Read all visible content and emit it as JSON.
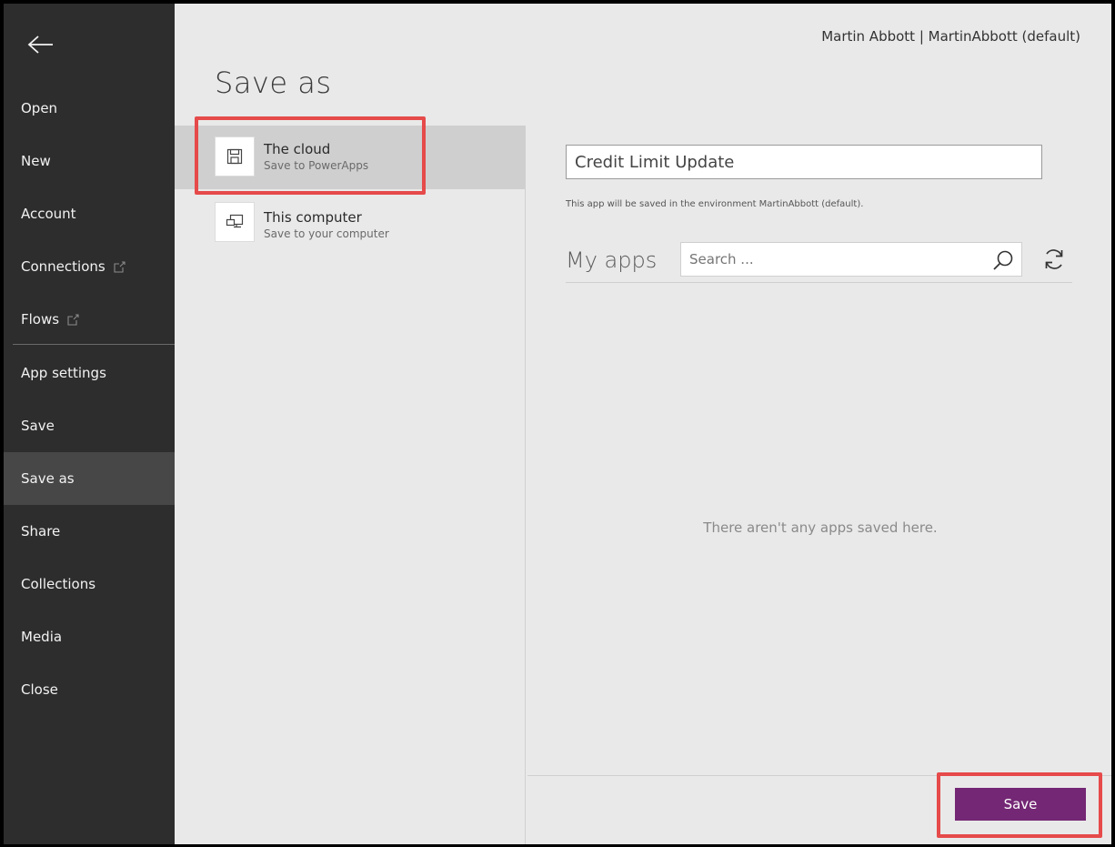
{
  "header": {
    "user": "Martin Abbott | MartinAbbott (default)",
    "title": "Save as"
  },
  "sidebar": {
    "back_icon": "back-arrow-icon",
    "items": [
      {
        "label": "Open"
      },
      {
        "label": "New"
      },
      {
        "label": "Account"
      },
      {
        "label": "Connections",
        "external": true
      },
      {
        "label": "Flows",
        "external": true
      },
      {
        "label": "App settings"
      },
      {
        "label": "Save"
      },
      {
        "label": "Save as",
        "active": true
      },
      {
        "label": "Share"
      },
      {
        "label": "Collections"
      },
      {
        "label": "Media"
      },
      {
        "label": "Close"
      }
    ]
  },
  "locations": [
    {
      "title": "The cloud",
      "subtitle": "Save to PowerApps",
      "icon": "save-icon",
      "selected": true
    },
    {
      "title": "This computer",
      "subtitle": "Save to your computer",
      "icon": "computer-icon",
      "selected": false
    }
  ],
  "main": {
    "app_name_value": "Credit Limit Update",
    "env_note": "This app will be saved in the environment MartinAbbott (default).",
    "my_apps_label": "My apps",
    "search_placeholder": "Search ...",
    "empty_message": "There aren't any apps saved here.",
    "save_label": "Save"
  },
  "colors": {
    "sidebar_bg": "#2d2d2d",
    "accent": "#742774",
    "highlight": "#e64a4a"
  }
}
